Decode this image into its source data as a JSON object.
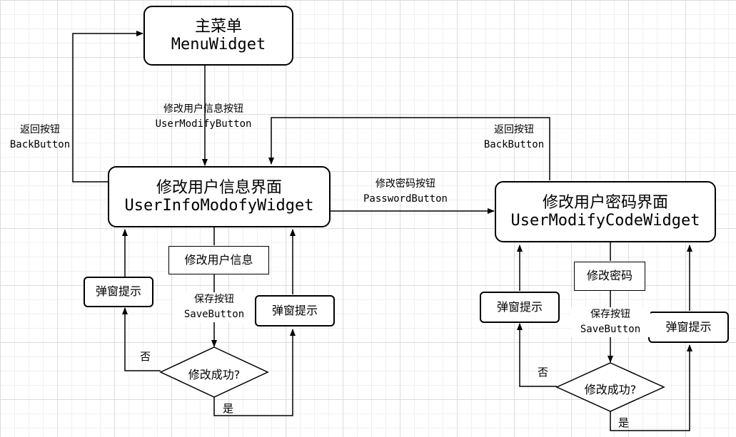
{
  "nodes": {
    "menu": {
      "cn": "主菜单",
      "code": "MenuWidget"
    },
    "user_info": {
      "cn": "修改用户信息界面",
      "code": "UserInfoModofyWidget"
    },
    "user_code": {
      "cn": "修改用户密码界面",
      "code": "UserModifyCodeWidget"
    },
    "modify_info": "修改用户信息",
    "modify_pwd": "修改密码",
    "popup_left_1": "弹窗提示",
    "popup_left_2": "弹窗提示",
    "popup_right_1": "弹窗提示",
    "popup_right_2": "弹窗提示",
    "decision_left": "修改成功?",
    "decision_right": "修改成功?"
  },
  "edge_labels": {
    "user_modify_btn": {
      "cn": "修改用户信息按钮",
      "code": "UserModifyButton"
    },
    "back_left": {
      "cn": "返回按钮",
      "code": "BackButton"
    },
    "back_right": {
      "cn": "返回按钮",
      "code": "BackButton"
    },
    "password_btn": {
      "cn": "修改密码按钮",
      "code": "PasswordButton"
    },
    "save_left": {
      "cn": "保存按钮",
      "code": "SaveButton"
    },
    "save_right": {
      "cn": "保存按钮",
      "code": "SaveButton"
    },
    "no_left": "否",
    "yes_left": "是",
    "no_right": "否",
    "yes_right": "是"
  }
}
